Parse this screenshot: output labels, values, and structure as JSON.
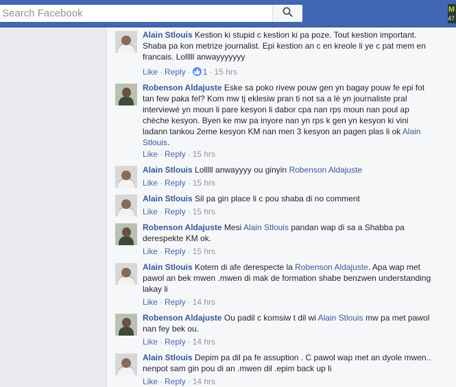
{
  "header": {
    "search_placeholder": "Search Facebook",
    "corner_text_top": "M",
    "corner_text_bottom": "47"
  },
  "comments": [
    {
      "author": "Alain Stlouis",
      "text": "Kestion ki stupid c kestion ki pa poze. Tout kestion important. Shaba pa kon metrize journalist. Epi kestion an c en kreole li ye c pat mem en francais. Lolllll anwayyyyyyy",
      "mention": "",
      "text_after": "",
      "like_label": "Like",
      "reply_label": "Reply",
      "likes": "1",
      "time": "15 hrs"
    },
    {
      "author": "Robenson Aldajuste",
      "text": "Eske sa poko rivew pouw gen yn bagay pouw fe epi fot tan few paka fel? Kom mw tj eklesiw pran ti not sa a lè yn journaliste pral interviewé yn moun li pare kesyon li dabor cpa nan rps moun nan poul ap chèche kesyon. Byen ke mw pa inyore nan yn rps k gen yn kesyon ki vini ladann tankou 2eme kesyon KM nan men 3 kesyon an pagen plas li ok",
      "mention": "Alain Stlouis",
      "text_after": ".",
      "like_label": "Like",
      "reply_label": "Reply",
      "time": "15 hrs"
    },
    {
      "author": "Alain Stlouis",
      "text": "Lolllll anwayyyy ou ginyin",
      "mention": "Robenson Aldajuste",
      "text_after": "",
      "like_label": "Like",
      "reply_label": "Reply",
      "time": "15 hrs"
    },
    {
      "author": "Alain Stlouis",
      "text": "Sil pa gin place li c pou shaba di no comment",
      "mention": "",
      "text_after": "",
      "like_label": "Like",
      "reply_label": "Reply",
      "time": "15 hrs"
    },
    {
      "author": "Robenson Aldajuste",
      "text": "Mesi",
      "mention": "Alain Stlouis",
      "text_after": "pandan wap di sa a Shabba pa derespekte KM ok.",
      "like_label": "Like",
      "reply_label": "Reply",
      "time": "15 hrs"
    },
    {
      "author": "Alain Stlouis",
      "text": "Kotem di afe derespecte la",
      "mention": "Robenson Aldajuste",
      "text_after": ". Apa wap met pawol an bek mwen .mwen di mak de formation shabe benzwen understanding lakay li",
      "like_label": "Like",
      "reply_label": "Reply",
      "time": "14 hrs"
    },
    {
      "author": "Robenson Aldajuste",
      "text": "Ou padil c komsiw t dil wi",
      "mention": "Alain Stlouis",
      "text_after": "mw pa met pawol nan fey bek ou.",
      "like_label": "Like",
      "reply_label": "Reply",
      "time": "14 hrs"
    },
    {
      "author": "Alain Stlouis",
      "text": "Depim pa dil pa fe assuption . C pawol wap met an dyole mwen.. nenpot sam gin pou di an .mwen dil .epim back up li",
      "mention": "",
      "text_after": "",
      "like_label": "Like",
      "reply_label": "Reply",
      "time": "14 hrs"
    }
  ],
  "colors": {
    "bar_blue": "#4267b2",
    "link_blue": "#365899",
    "meta_gray": "#90949c",
    "text_dark": "#1d2129"
  }
}
